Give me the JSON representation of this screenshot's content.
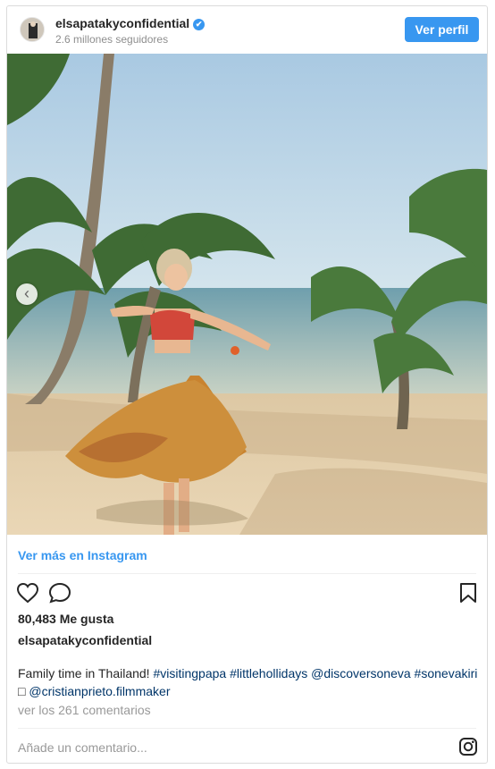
{
  "header": {
    "username": "elsapatakyconfidential",
    "followers": "2.6 millones seguidores",
    "follow_label": "Ver perfil",
    "verified_icon": "✔"
  },
  "photo": {
    "prev_icon": "‹"
  },
  "more_label": "Ver más en Instagram",
  "actions": {
    "like_icon": "heart-icon",
    "comment_icon": "comment-icon",
    "save_icon": "bookmark-icon"
  },
  "likes": "80,483 Me gusta",
  "author": "elsapatakyconfidential",
  "caption": {
    "text": "Family time in Thailand! ",
    "tags": [
      "#visitingpapa",
      "#littlehollidays",
      "@discoversoneva",
      "#sonevakiri"
    ],
    "emoji": "□",
    "mention": "@cristianprieto.filmmaker"
  },
  "comments_link": "ver los 261 comentarios",
  "comment_placeholder": "Añade un comentario...",
  "colors": {
    "accent": "#3897f0",
    "tag": "#003569"
  }
}
